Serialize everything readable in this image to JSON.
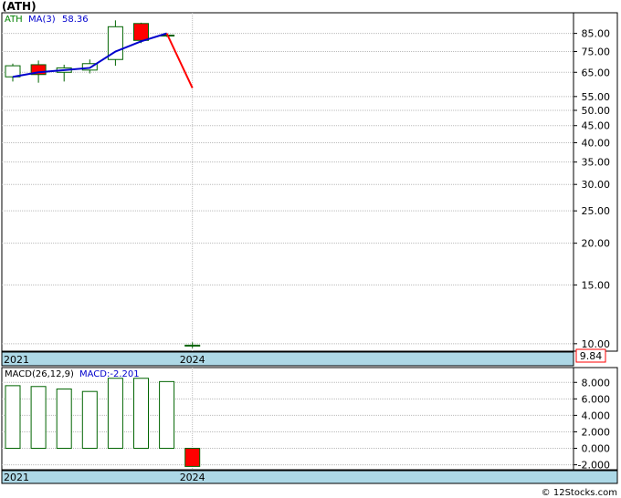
{
  "title": "(ATH)",
  "footer": "© 12Stocks.com",
  "colors": {
    "band": "#add8e6",
    "up": "#ffffff",
    "down": "#ff0000",
    "outline": "#006400",
    "ma": "#0000cd",
    "projection": "#ff0000",
    "grid": "#bbbbbb",
    "price_box": "#ff0000"
  },
  "chart_data": [
    {
      "type": "candlestick",
      "name": "price",
      "scale": "log",
      "ylim": [
        9.5,
        98
      ],
      "yticks": [
        85,
        75,
        65,
        55,
        50,
        45,
        40,
        35,
        30,
        25,
        20,
        15,
        10
      ],
      "ytick_labels": [
        "85.00",
        "75.00",
        "65.00",
        "55.00",
        "50.00",
        "45.00",
        "40.00",
        "35.00",
        "30.00",
        "25.00",
        "20.00",
        "15.00",
        "10.00"
      ],
      "x_labels": [
        {
          "index": 0,
          "label": "2021"
        },
        {
          "index": 7,
          "label": "2024"
        }
      ],
      "legend": {
        "symbol": "ATH",
        "ma_label": "MA(3)",
        "ma_value": "58.36"
      },
      "last_price": "9.84",
      "candles": [
        {
          "open": 63.0,
          "high": 69.0,
          "low": 61.0,
          "close": 68.0
        },
        {
          "open": 68.5,
          "high": 70.5,
          "low": 60.5,
          "close": 64.0
        },
        {
          "open": 65.0,
          "high": 68.5,
          "low": 61.0,
          "close": 67.0
        },
        {
          "open": 66.0,
          "high": 71.0,
          "low": 64.5,
          "close": 69.0
        },
        {
          "open": 71.0,
          "high": 93.0,
          "low": 68.0,
          "close": 89.0
        },
        {
          "open": 91.0,
          "high": 91.5,
          "low": 79.5,
          "close": 81.0
        },
        {
          "open": 84.0,
          "high": 85.0,
          "low": 83.0,
          "close": 84.0
        },
        {
          "open": 9.9,
          "high": 10.1,
          "low": 9.7,
          "close": 9.84
        }
      ],
      "ma": [
        {
          "index": 0,
          "value": 63.0
        },
        {
          "index": 1,
          "value": 65.0
        },
        {
          "index": 2,
          "value": 66.0
        },
        {
          "index": 3,
          "value": 67.0
        },
        {
          "index": 4,
          "value": 75.0
        },
        {
          "index": 5,
          "value": 80.5
        },
        {
          "index": 6,
          "value": 85.0
        }
      ],
      "projection": [
        {
          "index": 6,
          "value": 85.0
        },
        {
          "index": 7,
          "value": 58.36
        }
      ]
    },
    {
      "type": "bar",
      "name": "macd",
      "legend": {
        "label": "MACD(26,12,9)",
        "value_label": "MACD:-2.201"
      },
      "ylim": [
        -2.6,
        9.8
      ],
      "yticks": [
        8,
        6,
        4,
        2,
        0,
        -2
      ],
      "ytick_labels": [
        "8.000",
        "6.000",
        "4.000",
        "2.000",
        "0.000",
        "-2.000"
      ],
      "x_labels": [
        {
          "index": 0,
          "label": "2021"
        },
        {
          "index": 7,
          "label": "2024"
        }
      ],
      "values": [
        7.6,
        7.5,
        7.2,
        6.9,
        8.5,
        8.5,
        8.1,
        -2.201
      ]
    }
  ]
}
